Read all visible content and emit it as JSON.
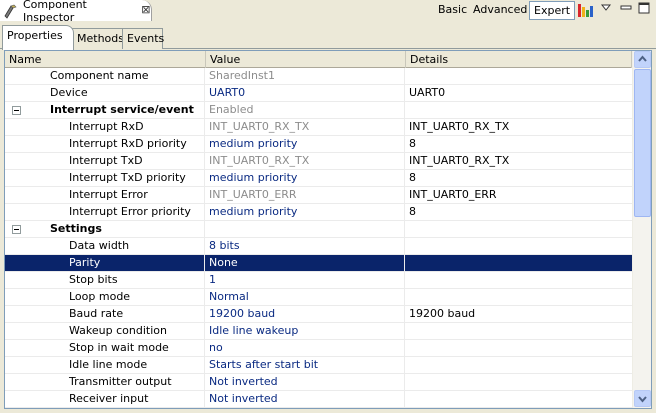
{
  "view": {
    "title": "Component Inspector",
    "close_symbol": "⊠",
    "modes": [
      "Basic",
      "Advanced",
      "Expert"
    ],
    "active_mode": "Expert",
    "icons": [
      "component-inspector-icon",
      "close-icon",
      "bar-chart-icon",
      "view-menu-icon",
      "minimize-icon",
      "maximize-icon"
    ]
  },
  "tabs": [
    "Properties",
    "Methods",
    "Events"
  ],
  "active_tab": "Properties",
  "columns": [
    "Name",
    "Value",
    "Details"
  ],
  "rows": [
    {
      "name": "Component name",
      "value": "SharedInst1",
      "details": "",
      "level": 1,
      "value_style": "gray"
    },
    {
      "name": "Device",
      "value": "UART0",
      "details": "UART0",
      "level": 1,
      "value_style": "blue"
    },
    {
      "name": "Interrupt service/event",
      "value": "Enabled",
      "details": "",
      "level": 0,
      "group": true,
      "value_style": "gray"
    },
    {
      "name": "Interrupt RxD",
      "value": "INT_UART0_RX_TX",
      "details": "INT_UART0_RX_TX",
      "level": 2,
      "value_style": "gray"
    },
    {
      "name": "Interrupt RxD priority",
      "value": "medium priority",
      "details": "8",
      "level": 2,
      "value_style": "blue"
    },
    {
      "name": "Interrupt TxD",
      "value": "INT_UART0_RX_TX",
      "details": "INT_UART0_RX_TX",
      "level": 2,
      "value_style": "gray"
    },
    {
      "name": "Interrupt TxD priority",
      "value": "medium priority",
      "details": "8",
      "level": 2,
      "value_style": "blue"
    },
    {
      "name": "Interrupt Error",
      "value": "INT_UART0_ERR",
      "details": "INT_UART0_ERR",
      "level": 2,
      "value_style": "gray"
    },
    {
      "name": "Interrupt Error priority",
      "value": "medium priority",
      "details": "8",
      "level": 2,
      "value_style": "blue"
    },
    {
      "name": "Settings",
      "value": "",
      "details": "",
      "level": 0,
      "group": true,
      "value_style": "blue"
    },
    {
      "name": "Data width",
      "value": "8 bits",
      "details": "",
      "level": 2,
      "value_style": "blue"
    },
    {
      "name": "Parity",
      "value": "None",
      "details": "",
      "level": 2,
      "value_style": "blue",
      "selected": true
    },
    {
      "name": "Stop bits",
      "value": "1",
      "details": "",
      "level": 2,
      "value_style": "blue"
    },
    {
      "name": "Loop mode",
      "value": "Normal",
      "details": "",
      "level": 2,
      "value_style": "blue"
    },
    {
      "name": "Baud rate",
      "value": "19200 baud",
      "details": "19200 baud",
      "level": 2,
      "value_style": "blue"
    },
    {
      "name": "Wakeup condition",
      "value": "Idle line wakeup",
      "details": "",
      "level": 2,
      "value_style": "blue"
    },
    {
      "name": "Stop in wait mode",
      "value": "no",
      "details": "",
      "level": 2,
      "value_style": "blue"
    },
    {
      "name": "Idle line mode",
      "value": "Starts after start bit",
      "details": "",
      "level": 2,
      "value_style": "blue"
    },
    {
      "name": "Transmitter output",
      "value": "Not inverted",
      "details": "",
      "level": 2,
      "value_style": "blue"
    },
    {
      "name": "Receiver input",
      "value": "Not inverted",
      "details": "",
      "level": 2,
      "value_style": "blue"
    }
  ]
}
